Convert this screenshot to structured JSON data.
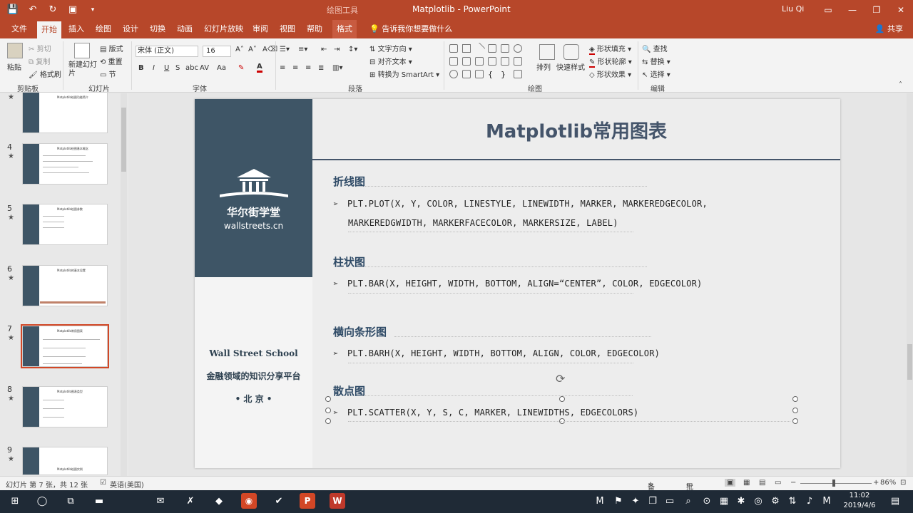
{
  "window": {
    "context_tab_group": "绘图工具",
    "document_title": "Matplotlib - PowerPoint",
    "user": "Liu Qi",
    "qat": [
      "save-icon",
      "undo-icon",
      "redo-icon",
      "present-icon",
      "customize-icon"
    ]
  },
  "tabs": [
    "文件",
    "开始",
    "插入",
    "绘图",
    "设计",
    "切换",
    "动画",
    "幻灯片放映",
    "审阅",
    "视图",
    "帮助",
    "格式"
  ],
  "active_tab": "开始",
  "tell_me": "告诉我你想要做什么",
  "share": "共享",
  "ribbon": {
    "clipboard": {
      "paste": "粘贴",
      "cut": "剪切",
      "copy": "复制",
      "format_painter": "格式刷",
      "label": "剪贴板"
    },
    "slides": {
      "new_slide": "新建幻灯片",
      "layout": "版式",
      "reset": "重置",
      "section": "节",
      "label": "幻灯片"
    },
    "font": {
      "font_name": "宋体 (正文)",
      "font_size": "16",
      "bold": "B",
      "italic": "I",
      "underline": "U",
      "strike": "S",
      "shadow": "abc",
      "spacing": "AV",
      "case": "Aa",
      "label": "字体"
    },
    "paragraph": {
      "text_direction": "文字方向",
      "align_text": "对齐文本",
      "smartart": "转换为 SmartArt",
      "label": "段落"
    },
    "drawing": {
      "arrange": "排列",
      "quick_styles": "快速样式",
      "fill": "形状填充",
      "outline": "形状轮廓",
      "effects": "形状效果",
      "label": "绘图"
    },
    "editing": {
      "find": "查找",
      "replace": "替换",
      "select": "选择",
      "label": "编辑"
    }
  },
  "thumbnails": [
    {
      "num": "",
      "title": "Matplotlib绘图功能简介"
    },
    {
      "num": "4",
      "title": "Matplotlib绘图基本概念"
    },
    {
      "num": "5",
      "title": "Matplotlib绘图参数"
    },
    {
      "num": "6",
      "title": "Matplotlib的基本设置"
    },
    {
      "num": "7",
      "title": "Matplotlib常用图表"
    },
    {
      "num": "8",
      "title": "Matplotlib图表类型"
    },
    {
      "num": "9",
      "title": "Matplotlib绘图实例"
    }
  ],
  "slide": {
    "school_cn": "华尔街学堂",
    "school_url": "wallstreets.cn",
    "school_en": "Wall Street School",
    "slogan": "金融领域的知识分享平台",
    "city": "• 北 京 •",
    "title": "Matplotlib常用图表",
    "sections": [
      {
        "heading": "折线图",
        "lines": [
          "PLT.PLOT(X, Y, COLOR, LINESTYLE, LINEWIDTH, MARKER, MARKEREDGECOLOR,",
          "MARKEREDGWIDTH, MARKERFACECOLOR, MARKERSIZE, LABEL)"
        ]
      },
      {
        "heading": "柱状图",
        "lines": [
          "PLT.BAR(X, HEIGHT, WIDTH, BOTTOM, ALIGN=“CENTER”, COLOR, EDGECOLOR)"
        ]
      },
      {
        "heading": "横向条形图",
        "lines": [
          "PLT.BARH(X, HEIGHT, WIDTH, BOTTOM, ALIGN, COLOR, EDGECOLOR)"
        ]
      },
      {
        "heading": "散点图",
        "lines": [
          "PLT.SCATTER(X, Y, S, C, MARKER, LINEWIDTHS, EDGECOLORS)"
        ]
      }
    ],
    "bullet": "➢"
  },
  "status": {
    "slide_info": "幻灯片 第 7 张，共 12 张",
    "language": "英语(美国)",
    "notes": "备注",
    "comments": "批注",
    "zoom": "86%"
  },
  "taskbar": {
    "time": "11:02",
    "date": "2019/4/6"
  }
}
